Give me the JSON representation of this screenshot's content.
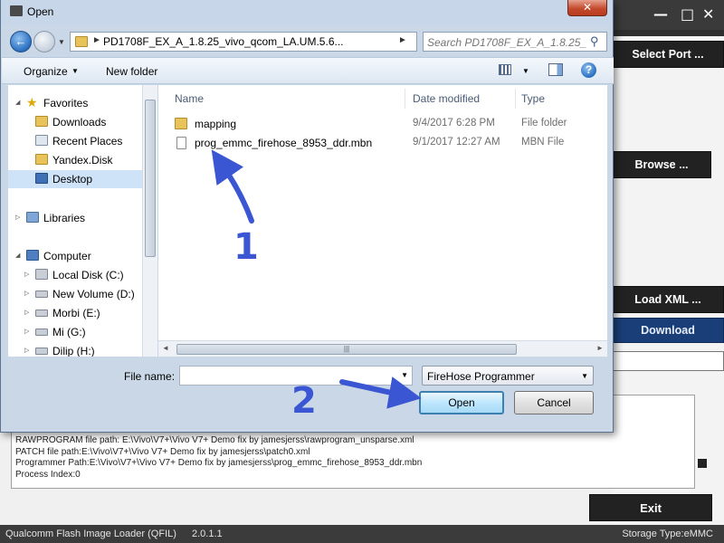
{
  "qfil": {
    "buttons": {
      "select_port": "Select Port ...",
      "browse": "Browse ...",
      "load_xml": "Load XML ...",
      "download": "Download",
      "exit": "Exit"
    },
    "log_lines": [
      "RAWPROGRAM file path: E:\\Vivo\\V7+\\Vivo V7+ Demo fix by jamesjerss\\rawprogram_unsparse.xml",
      "PATCH file path:E:\\Vivo\\V7+\\Vivo V7+ Demo fix by jamesjerss\\patch0.xml",
      "Programmer Path:E:\\Vivo\\V7+\\Vivo V7+ Demo fix by jamesjerss\\prog_emmc_firehose_8953_ddr.mbn",
      "Process Index:0"
    ],
    "statusbar": {
      "app_name": "Qualcomm Flash Image Loader (QFIL)",
      "version": "2.0.1.1",
      "storage": "Storage Type:eMMC"
    },
    "accent_color": "#1a3e78"
  },
  "dialog": {
    "title": "Open",
    "address_path": "PD1708F_EX_A_1.8.25_vivo_qcom_LA.UM.5.6...",
    "search_placeholder": "Search PD1708F_EX_A_1.8.25_...",
    "toolbar": {
      "organize": "Organize",
      "new_folder": "New folder"
    },
    "nav": {
      "favorites": "Favorites",
      "downloads": "Downloads",
      "recent_places": "Recent Places",
      "yandex_disk": "Yandex.Disk",
      "desktop": "Desktop",
      "libraries": "Libraries",
      "computer": "Computer",
      "drives": [
        "Local Disk (C:)",
        "New Volume (D:)",
        "Morbi (E:)",
        "Mi (G:)",
        "Dilip (H:)"
      ]
    },
    "columns": {
      "name": "Name",
      "date_modified": "Date modified",
      "type": "Type"
    },
    "files": [
      {
        "name": "mapping",
        "date": "9/4/2017 6:28 PM",
        "type": "File folder",
        "icon": "folder-icon"
      },
      {
        "name": "prog_emmc_firehose_8953_ddr.mbn",
        "date": "9/1/2017 12:27 AM",
        "type": "MBN File",
        "icon": "file-icon"
      }
    ],
    "file_name_label": "File name:",
    "file_name_value": "",
    "file_type": "FireHose Programmer",
    "open_label": "Open",
    "cancel_label": "Cancel"
  },
  "annotations": {
    "step1": "1",
    "step2": "2",
    "color": "#3a56d3"
  }
}
